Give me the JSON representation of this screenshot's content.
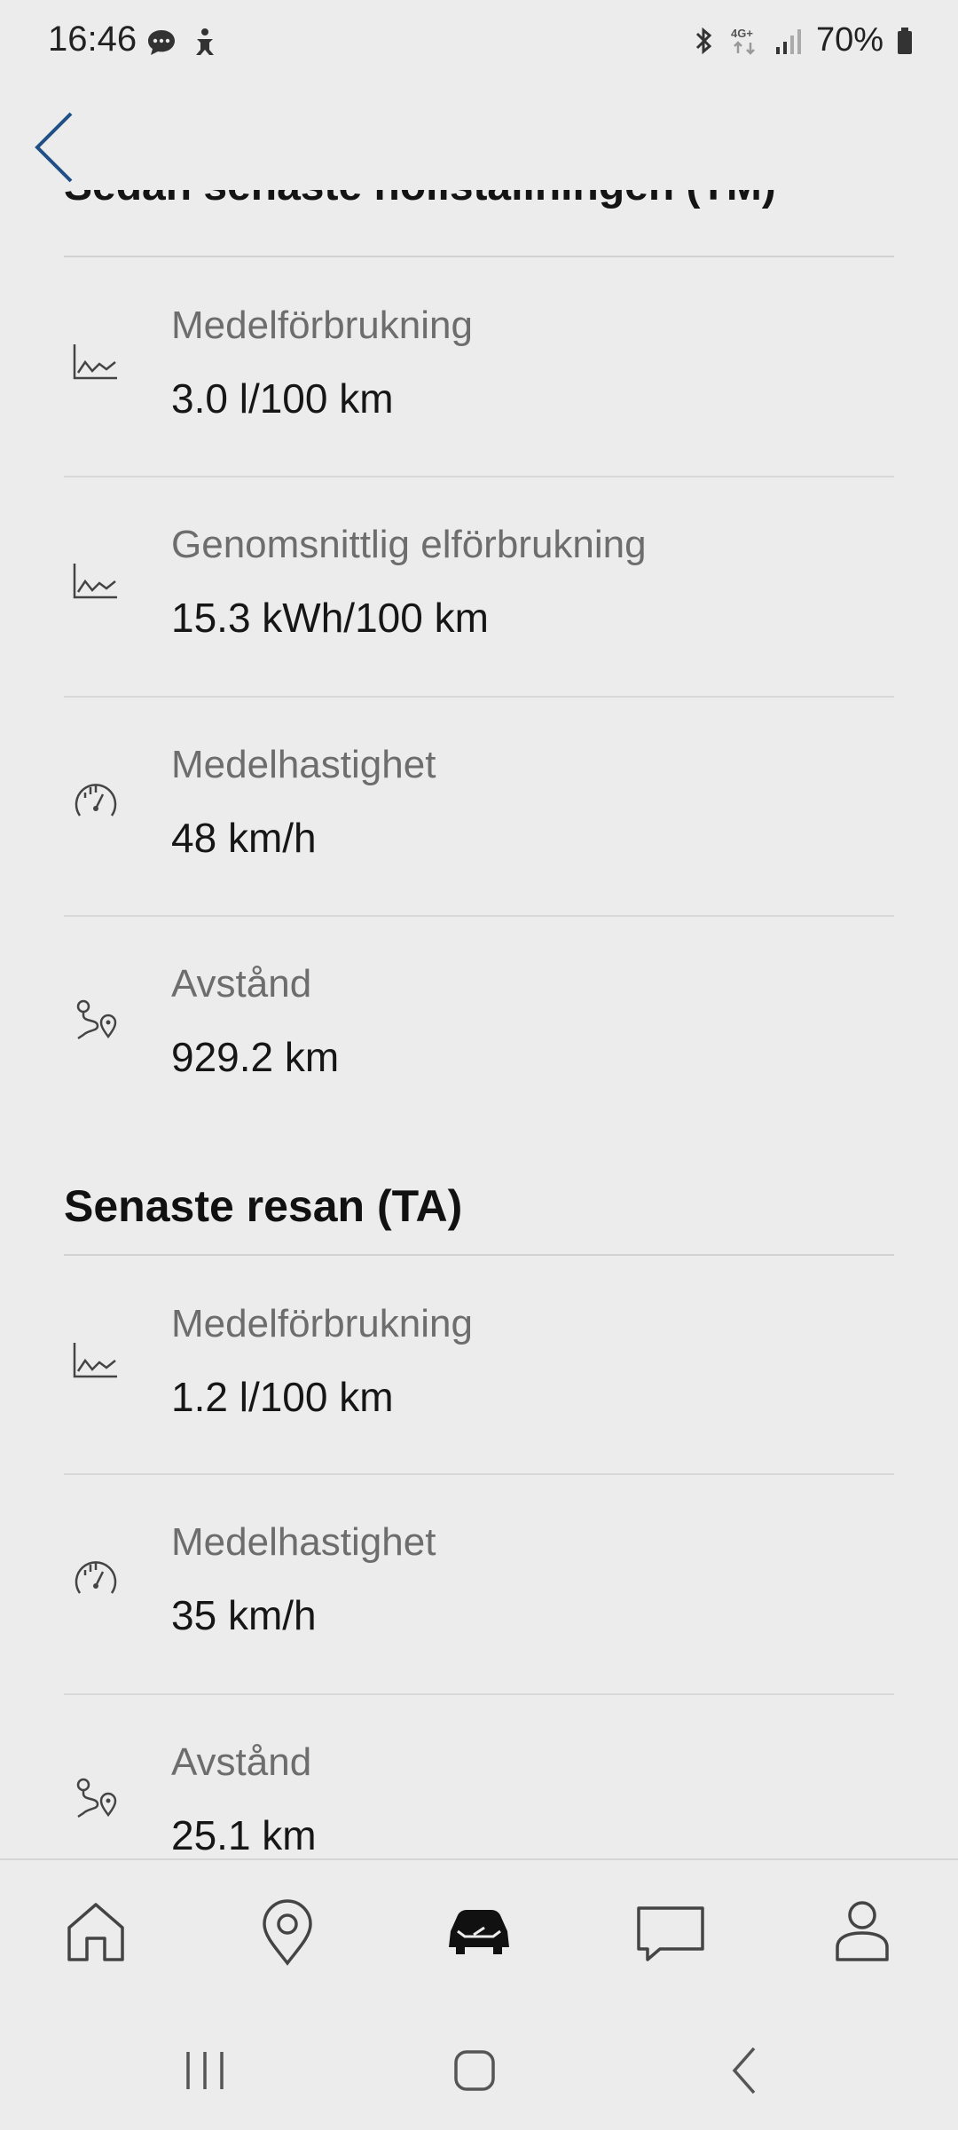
{
  "status_bar": {
    "time": "16:46",
    "battery": "70%",
    "network": "4G+"
  },
  "header": {
    "back_icon": "chevron-left-icon",
    "clipped_heading": "Sedan senaste nollställningen (TM)"
  },
  "section_tm": {
    "rows": [
      {
        "icon": "chart-line-icon",
        "label": "Medelförbrukning",
        "value": "3.0 l/100 km"
      },
      {
        "icon": "chart-line-icon",
        "label": "Genomsnittlig elförbrukning",
        "value": "15.3 kWh/100 km"
      },
      {
        "icon": "speedometer-icon",
        "label": "Medelhastighet",
        "value": "48 km/h"
      },
      {
        "icon": "route-icon",
        "label": "Avstånd",
        "value": "929.2 km"
      }
    ]
  },
  "section_ta": {
    "title": "Senaste resan (TA)",
    "rows": [
      {
        "icon": "chart-line-icon",
        "label": "Medelförbrukning",
        "value": "1.2 l/100 km"
      },
      {
        "icon": "speedometer-icon",
        "label": "Medelhastighet",
        "value": "35 km/h"
      },
      {
        "icon": "route-icon",
        "label": "Avstånd",
        "value": "25.1 km"
      }
    ]
  },
  "tabbar": {
    "tabs": [
      {
        "name": "home",
        "icon": "home-icon"
      },
      {
        "name": "map",
        "icon": "location-pin-icon"
      },
      {
        "name": "car",
        "icon": "car-icon",
        "active": true
      },
      {
        "name": "messages",
        "icon": "chat-icon"
      },
      {
        "name": "profile",
        "icon": "user-icon"
      }
    ]
  },
  "colors": {
    "background": "#ececec",
    "accent": "#1f4f86",
    "label": "#6d6d6d",
    "value": "#161616"
  }
}
